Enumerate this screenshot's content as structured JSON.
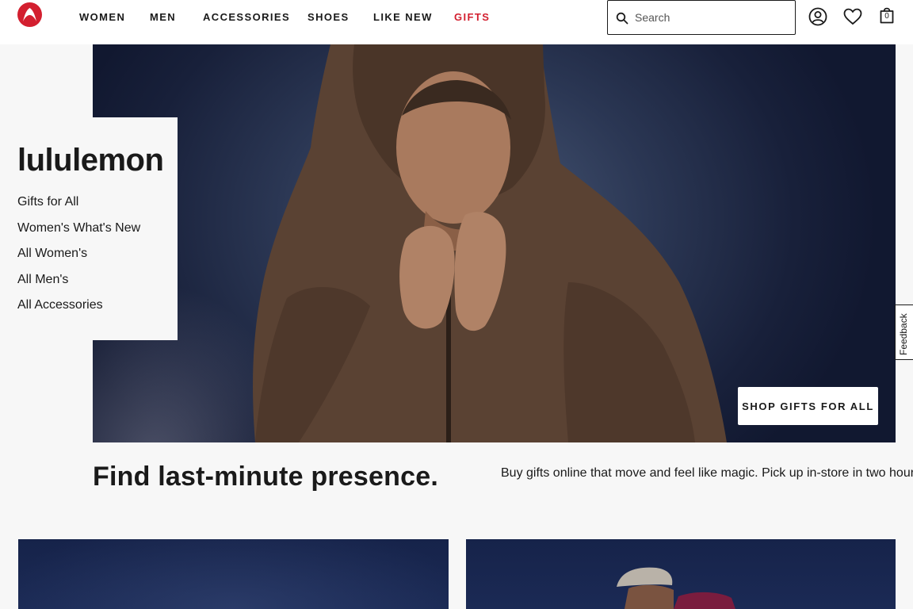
{
  "header": {
    "brand_logo": "lululemon-logo",
    "nav": [
      {
        "label": "WOMEN"
      },
      {
        "label": "MEN"
      },
      {
        "label": "ACCESSORIES"
      },
      {
        "label": "SHOES"
      },
      {
        "label": "LIKE NEW"
      },
      {
        "label": "GIFTS"
      }
    ],
    "search": {
      "placeholder": "Search",
      "value": ""
    },
    "icons": [
      "account-icon",
      "wishlist-heart-icon",
      "shopping-bag-icon"
    ],
    "bag_count": "0"
  },
  "hero": {
    "brand": "lululemon",
    "links": [
      "Gifts for All",
      "Women's What's New",
      "All Women's",
      "All Men's",
      "All Accessories"
    ],
    "cta_label": "SHOP GIFTS FOR ALL"
  },
  "feedback_label": "Feedback",
  "promo": {
    "headline": "Find last-minute presence.",
    "subline": "Buy gifts online that move and feel like magic. Pick up in-store in two hours."
  },
  "colors": {
    "accent": "#d31f2f",
    "text": "#1a1a1a",
    "background": "#f7f7f7",
    "hero_bg": "#1b2a48"
  }
}
